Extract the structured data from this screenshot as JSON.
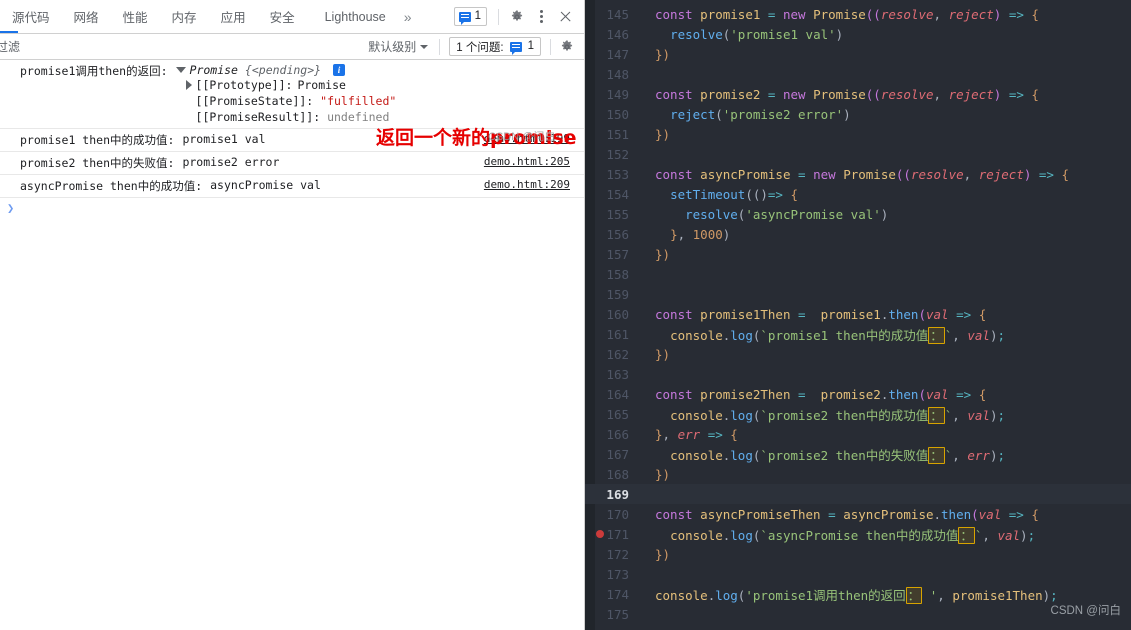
{
  "devtools": {
    "tabs": [
      {
        "label": "源代码",
        "active": false
      },
      {
        "label": "网络",
        "active": false
      },
      {
        "label": "性能",
        "active": false
      },
      {
        "label": "内存",
        "active": false
      },
      {
        "label": "应用",
        "active": false
      },
      {
        "label": "安全",
        "active": false
      },
      {
        "label": "Lighthouse",
        "active": false
      }
    ],
    "more_label": "»",
    "toolbar": {
      "issue_count": "1",
      "message_icon": "message-icon",
      "settings_icon": "gear-icon",
      "menu_icon": "kebab-menu-icon",
      "close_icon": "close-icon"
    },
    "filterbar": {
      "filter_placeholder": "过滤",
      "filter_value": "",
      "level_label": "默认级别",
      "issues_label": "1 个问题:",
      "issues_count": "1",
      "settings_icon": "gear-icon"
    },
    "messages": [
      {
        "type": "object",
        "label": "promise1调用then的返回:",
        "object_name": "Promise",
        "object_state": "{<pending>}",
        "info_badge": "i",
        "expanded": true,
        "props": [
          {
            "key": "[[Prototype]]:",
            "value": "Promise",
            "value_kind": "plain",
            "expandable": true
          },
          {
            "key": "[[PromiseState]]:",
            "value": "\"fulfilled\"",
            "value_kind": "string",
            "expandable": false
          },
          {
            "key": "[[PromiseResult]]:",
            "value": "undefined",
            "value_kind": "undefined",
            "expandable": false
          }
        ],
        "source": ""
      },
      {
        "type": "log",
        "label": "promise1 then中的成功值:",
        "value": "promise1 val",
        "source": "demo.html:199"
      },
      {
        "type": "log",
        "label": "promise2 then中的失败值:",
        "value": "promise2 error",
        "source": "demo.html:205"
      },
      {
        "type": "log",
        "label": "asyncPromise then中的成功值:",
        "value": "asyncPromise val",
        "source": "demo.html:209"
      }
    ],
    "prompt_symbol": "❯",
    "annotation": "返回一个新的promise",
    "annotation_watermark": "CSDN @问白"
  },
  "editor": {
    "watermark": "CSDN @问白",
    "active_line": 169,
    "breakpoint_line": 171,
    "lines": [
      {
        "n": 145,
        "tokens": [
          {
            "t": "const",
            "c": "t-kw"
          },
          {
            "t": " ",
            "c": "t-pun"
          },
          {
            "t": "promise1",
            "c": "t-var"
          },
          {
            "t": " ",
            "c": "t-pun"
          },
          {
            "t": "=",
            "c": "t-op"
          },
          {
            "t": " ",
            "c": "t-pun"
          },
          {
            "t": "new",
            "c": "t-kw"
          },
          {
            "t": " ",
            "c": "t-pun"
          },
          {
            "t": "Promise",
            "c": "t-var"
          },
          {
            "t": "((",
            "c": "t-par"
          },
          {
            "t": "resolve",
            "c": "t-arg"
          },
          {
            "t": ", ",
            "c": "t-pun"
          },
          {
            "t": "reject",
            "c": "t-arg"
          },
          {
            "t": ")",
            "c": "t-par"
          },
          {
            "t": " ",
            "c": "t-pun"
          },
          {
            "t": "=>",
            "c": "t-op"
          },
          {
            "t": " ",
            "c": "t-pun"
          },
          {
            "t": "{",
            "c": "t-brace"
          }
        ]
      },
      {
        "n": 146,
        "indent": 1,
        "tokens": [
          {
            "t": "  ",
            "c": "t-pun"
          },
          {
            "t": "resolve",
            "c": "t-fn"
          },
          {
            "t": "(",
            "c": "t-pun"
          },
          {
            "t": "'promise1 val'",
            "c": "t-str"
          },
          {
            "t": ")",
            "c": "t-pun"
          }
        ]
      },
      {
        "n": 147,
        "tokens": [
          {
            "t": "})",
            "c": "t-brace"
          }
        ]
      },
      {
        "n": 148,
        "tokens": []
      },
      {
        "n": 149,
        "tokens": [
          {
            "t": "const",
            "c": "t-kw"
          },
          {
            "t": " ",
            "c": "t-pun"
          },
          {
            "t": "promise2",
            "c": "t-var"
          },
          {
            "t": " ",
            "c": "t-pun"
          },
          {
            "t": "=",
            "c": "t-op"
          },
          {
            "t": " ",
            "c": "t-pun"
          },
          {
            "t": "new",
            "c": "t-kw"
          },
          {
            "t": " ",
            "c": "t-pun"
          },
          {
            "t": "Promise",
            "c": "t-var"
          },
          {
            "t": "((",
            "c": "t-par"
          },
          {
            "t": "resolve",
            "c": "t-arg"
          },
          {
            "t": ", ",
            "c": "t-pun"
          },
          {
            "t": "reject",
            "c": "t-arg"
          },
          {
            "t": ")",
            "c": "t-par"
          },
          {
            "t": " ",
            "c": "t-pun"
          },
          {
            "t": "=>",
            "c": "t-op"
          },
          {
            "t": " ",
            "c": "t-pun"
          },
          {
            "t": "{",
            "c": "t-brace"
          }
        ]
      },
      {
        "n": 150,
        "indent": 1,
        "tokens": [
          {
            "t": "  ",
            "c": "t-pun"
          },
          {
            "t": "reject",
            "c": "t-fn"
          },
          {
            "t": "(",
            "c": "t-pun"
          },
          {
            "t": "'promise2 error'",
            "c": "t-str"
          },
          {
            "t": ")",
            "c": "t-pun"
          }
        ]
      },
      {
        "n": 151,
        "tokens": [
          {
            "t": "})",
            "c": "t-brace"
          }
        ]
      },
      {
        "n": 152,
        "tokens": []
      },
      {
        "n": 153,
        "tokens": [
          {
            "t": "const",
            "c": "t-kw"
          },
          {
            "t": " ",
            "c": "t-pun"
          },
          {
            "t": "asyncPromise",
            "c": "t-var"
          },
          {
            "t": " ",
            "c": "t-pun"
          },
          {
            "t": "=",
            "c": "t-op"
          },
          {
            "t": " ",
            "c": "t-pun"
          },
          {
            "t": "new",
            "c": "t-kw"
          },
          {
            "t": " ",
            "c": "t-pun"
          },
          {
            "t": "Promise",
            "c": "t-var"
          },
          {
            "t": "((",
            "c": "t-par"
          },
          {
            "t": "resolve",
            "c": "t-arg"
          },
          {
            "t": ", ",
            "c": "t-pun"
          },
          {
            "t": "reject",
            "c": "t-arg"
          },
          {
            "t": ")",
            "c": "t-par"
          },
          {
            "t": " ",
            "c": "t-pun"
          },
          {
            "t": "=>",
            "c": "t-op"
          },
          {
            "t": " ",
            "c": "t-pun"
          },
          {
            "t": "{",
            "c": "t-brace"
          }
        ]
      },
      {
        "n": 154,
        "indent": 1,
        "tokens": [
          {
            "t": "  ",
            "c": "t-pun"
          },
          {
            "t": "setTimeout",
            "c": "t-fn"
          },
          {
            "t": "(()",
            "c": "t-pun"
          },
          {
            "t": "=>",
            "c": "t-op"
          },
          {
            "t": " ",
            "c": "t-pun"
          },
          {
            "t": "{",
            "c": "t-brace"
          }
        ]
      },
      {
        "n": 155,
        "indent": 2,
        "tokens": [
          {
            "t": "    ",
            "c": "t-pun"
          },
          {
            "t": "resolve",
            "c": "t-fn"
          },
          {
            "t": "(",
            "c": "t-pun"
          },
          {
            "t": "'asyncPromise val'",
            "c": "t-str"
          },
          {
            "t": ")",
            "c": "t-pun"
          }
        ]
      },
      {
        "n": 156,
        "indent": 1,
        "tokens": [
          {
            "t": "  ",
            "c": "t-pun"
          },
          {
            "t": "}",
            "c": "t-brace"
          },
          {
            "t": ", ",
            "c": "t-pun"
          },
          {
            "t": "1000",
            "c": "t-num"
          },
          {
            "t": ")",
            "c": "t-pun"
          }
        ]
      },
      {
        "n": 157,
        "tokens": [
          {
            "t": "})",
            "c": "t-brace"
          }
        ]
      },
      {
        "n": 158,
        "tokens": []
      },
      {
        "n": 159,
        "tokens": []
      },
      {
        "n": 160,
        "tokens": [
          {
            "t": "const",
            "c": "t-kw"
          },
          {
            "t": " ",
            "c": "t-pun"
          },
          {
            "t": "promise1Then",
            "c": "t-var"
          },
          {
            "t": " ",
            "c": "t-pun"
          },
          {
            "t": "=",
            "c": "t-op"
          },
          {
            "t": "  ",
            "c": "t-pun"
          },
          {
            "t": "promise1",
            "c": "t-var"
          },
          {
            "t": ".",
            "c": "t-pun"
          },
          {
            "t": "then",
            "c": "t-fn"
          },
          {
            "t": "(",
            "c": "t-par"
          },
          {
            "t": "val",
            "c": "t-arg"
          },
          {
            "t": " ",
            "c": "t-pun"
          },
          {
            "t": "=>",
            "c": "t-op"
          },
          {
            "t": " ",
            "c": "t-pun"
          },
          {
            "t": "{",
            "c": "t-brace"
          }
        ]
      },
      {
        "n": 161,
        "indent": 1,
        "tokens": [
          {
            "t": "  ",
            "c": "t-pun"
          },
          {
            "t": "console",
            "c": "t-var"
          },
          {
            "t": ".",
            "c": "t-pun"
          },
          {
            "t": "log",
            "c": "t-fn"
          },
          {
            "t": "(",
            "c": "t-pun"
          },
          {
            "t": "`promise1 then中的成功值",
            "c": "t-str"
          },
          {
            "t": "：",
            "c": "hl"
          },
          {
            "t": "`",
            "c": "t-str"
          },
          {
            "t": ", ",
            "c": "t-pun"
          },
          {
            "t": "val",
            "c": "t-arg"
          },
          {
            "t": ")",
            "c": "t-pun"
          },
          {
            "t": ";",
            "c": "t-op"
          }
        ]
      },
      {
        "n": 162,
        "tokens": [
          {
            "t": "})",
            "c": "t-brace"
          }
        ]
      },
      {
        "n": 163,
        "tokens": []
      },
      {
        "n": 164,
        "tokens": [
          {
            "t": "const",
            "c": "t-kw"
          },
          {
            "t": " ",
            "c": "t-pun"
          },
          {
            "t": "promise2Then",
            "c": "t-var"
          },
          {
            "t": " ",
            "c": "t-pun"
          },
          {
            "t": "=",
            "c": "t-op"
          },
          {
            "t": "  ",
            "c": "t-pun"
          },
          {
            "t": "promise2",
            "c": "t-var"
          },
          {
            "t": ".",
            "c": "t-pun"
          },
          {
            "t": "then",
            "c": "t-fn"
          },
          {
            "t": "(",
            "c": "t-par"
          },
          {
            "t": "val",
            "c": "t-arg"
          },
          {
            "t": " ",
            "c": "t-pun"
          },
          {
            "t": "=>",
            "c": "t-op"
          },
          {
            "t": " ",
            "c": "t-pun"
          },
          {
            "t": "{",
            "c": "t-brace"
          }
        ]
      },
      {
        "n": 165,
        "indent": 1,
        "tokens": [
          {
            "t": "  ",
            "c": "t-pun"
          },
          {
            "t": "console",
            "c": "t-var"
          },
          {
            "t": ".",
            "c": "t-pun"
          },
          {
            "t": "log",
            "c": "t-fn"
          },
          {
            "t": "(",
            "c": "t-pun"
          },
          {
            "t": "`promise2 then中的成功值",
            "c": "t-str"
          },
          {
            "t": "：",
            "c": "hl"
          },
          {
            "t": "`",
            "c": "t-str"
          },
          {
            "t": ", ",
            "c": "t-pun"
          },
          {
            "t": "val",
            "c": "t-arg"
          },
          {
            "t": ")",
            "c": "t-pun"
          },
          {
            "t": ";",
            "c": "t-op"
          }
        ]
      },
      {
        "n": 166,
        "tokens": [
          {
            "t": "}",
            "c": "t-brace"
          },
          {
            "t": ", ",
            "c": "t-pun"
          },
          {
            "t": "err",
            "c": "t-arg"
          },
          {
            "t": " ",
            "c": "t-pun"
          },
          {
            "t": "=>",
            "c": "t-op"
          },
          {
            "t": " ",
            "c": "t-pun"
          },
          {
            "t": "{",
            "c": "t-brace"
          }
        ]
      },
      {
        "n": 167,
        "indent": 1,
        "tokens": [
          {
            "t": "  ",
            "c": "t-pun"
          },
          {
            "t": "console",
            "c": "t-var"
          },
          {
            "t": ".",
            "c": "t-pun"
          },
          {
            "t": "log",
            "c": "t-fn"
          },
          {
            "t": "(",
            "c": "t-pun"
          },
          {
            "t": "`promise2 then中的失败值",
            "c": "t-str"
          },
          {
            "t": "：",
            "c": "hl"
          },
          {
            "t": "`",
            "c": "t-str"
          },
          {
            "t": ", ",
            "c": "t-pun"
          },
          {
            "t": "err",
            "c": "t-arg"
          },
          {
            "t": ")",
            "c": "t-pun"
          },
          {
            "t": ";",
            "c": "t-op"
          }
        ]
      },
      {
        "n": 168,
        "tokens": [
          {
            "t": "})",
            "c": "t-brace"
          }
        ]
      },
      {
        "n": 169,
        "tokens": []
      },
      {
        "n": 170,
        "tokens": [
          {
            "t": "const",
            "c": "t-kw"
          },
          {
            "t": " ",
            "c": "t-pun"
          },
          {
            "t": "asyncPromiseThen",
            "c": "t-var"
          },
          {
            "t": " ",
            "c": "t-pun"
          },
          {
            "t": "=",
            "c": "t-op"
          },
          {
            "t": " ",
            "c": "t-pun"
          },
          {
            "t": "asyncPromise",
            "c": "t-var"
          },
          {
            "t": ".",
            "c": "t-pun"
          },
          {
            "t": "then",
            "c": "t-fn"
          },
          {
            "t": "(",
            "c": "t-par"
          },
          {
            "t": "val",
            "c": "t-arg"
          },
          {
            "t": " ",
            "c": "t-pun"
          },
          {
            "t": "=>",
            "c": "t-op"
          },
          {
            "t": " ",
            "c": "t-pun"
          },
          {
            "t": "{",
            "c": "t-brace"
          }
        ]
      },
      {
        "n": 171,
        "indent": 1,
        "tokens": [
          {
            "t": "  ",
            "c": "t-pun"
          },
          {
            "t": "console",
            "c": "t-var"
          },
          {
            "t": ".",
            "c": "t-pun"
          },
          {
            "t": "log",
            "c": "t-fn"
          },
          {
            "t": "(",
            "c": "t-pun"
          },
          {
            "t": "`asyncPromise then中的成功值",
            "c": "t-str"
          },
          {
            "t": "：",
            "c": "hl"
          },
          {
            "t": "`",
            "c": "t-str"
          },
          {
            "t": ", ",
            "c": "t-pun"
          },
          {
            "t": "val",
            "c": "t-arg"
          },
          {
            "t": ")",
            "c": "t-pun"
          },
          {
            "t": ";",
            "c": "t-op"
          }
        ]
      },
      {
        "n": 172,
        "tokens": [
          {
            "t": "})",
            "c": "t-brace"
          }
        ]
      },
      {
        "n": 173,
        "tokens": []
      },
      {
        "n": 174,
        "tokens": [
          {
            "t": "console",
            "c": "t-var"
          },
          {
            "t": ".",
            "c": "t-pun"
          },
          {
            "t": "log",
            "c": "t-fn"
          },
          {
            "t": "(",
            "c": "t-pun"
          },
          {
            "t": "'promise1调用then的返回",
            "c": "t-str"
          },
          {
            "t": "：",
            "c": "hl"
          },
          {
            "t": " '",
            "c": "t-str"
          },
          {
            "t": ", ",
            "c": "t-pun"
          },
          {
            "t": "promise1Then",
            "c": "t-var"
          },
          {
            "t": ")",
            "c": "t-pun"
          },
          {
            "t": ";",
            "c": "t-op"
          }
        ]
      },
      {
        "n": 175,
        "tokens": []
      }
    ]
  }
}
